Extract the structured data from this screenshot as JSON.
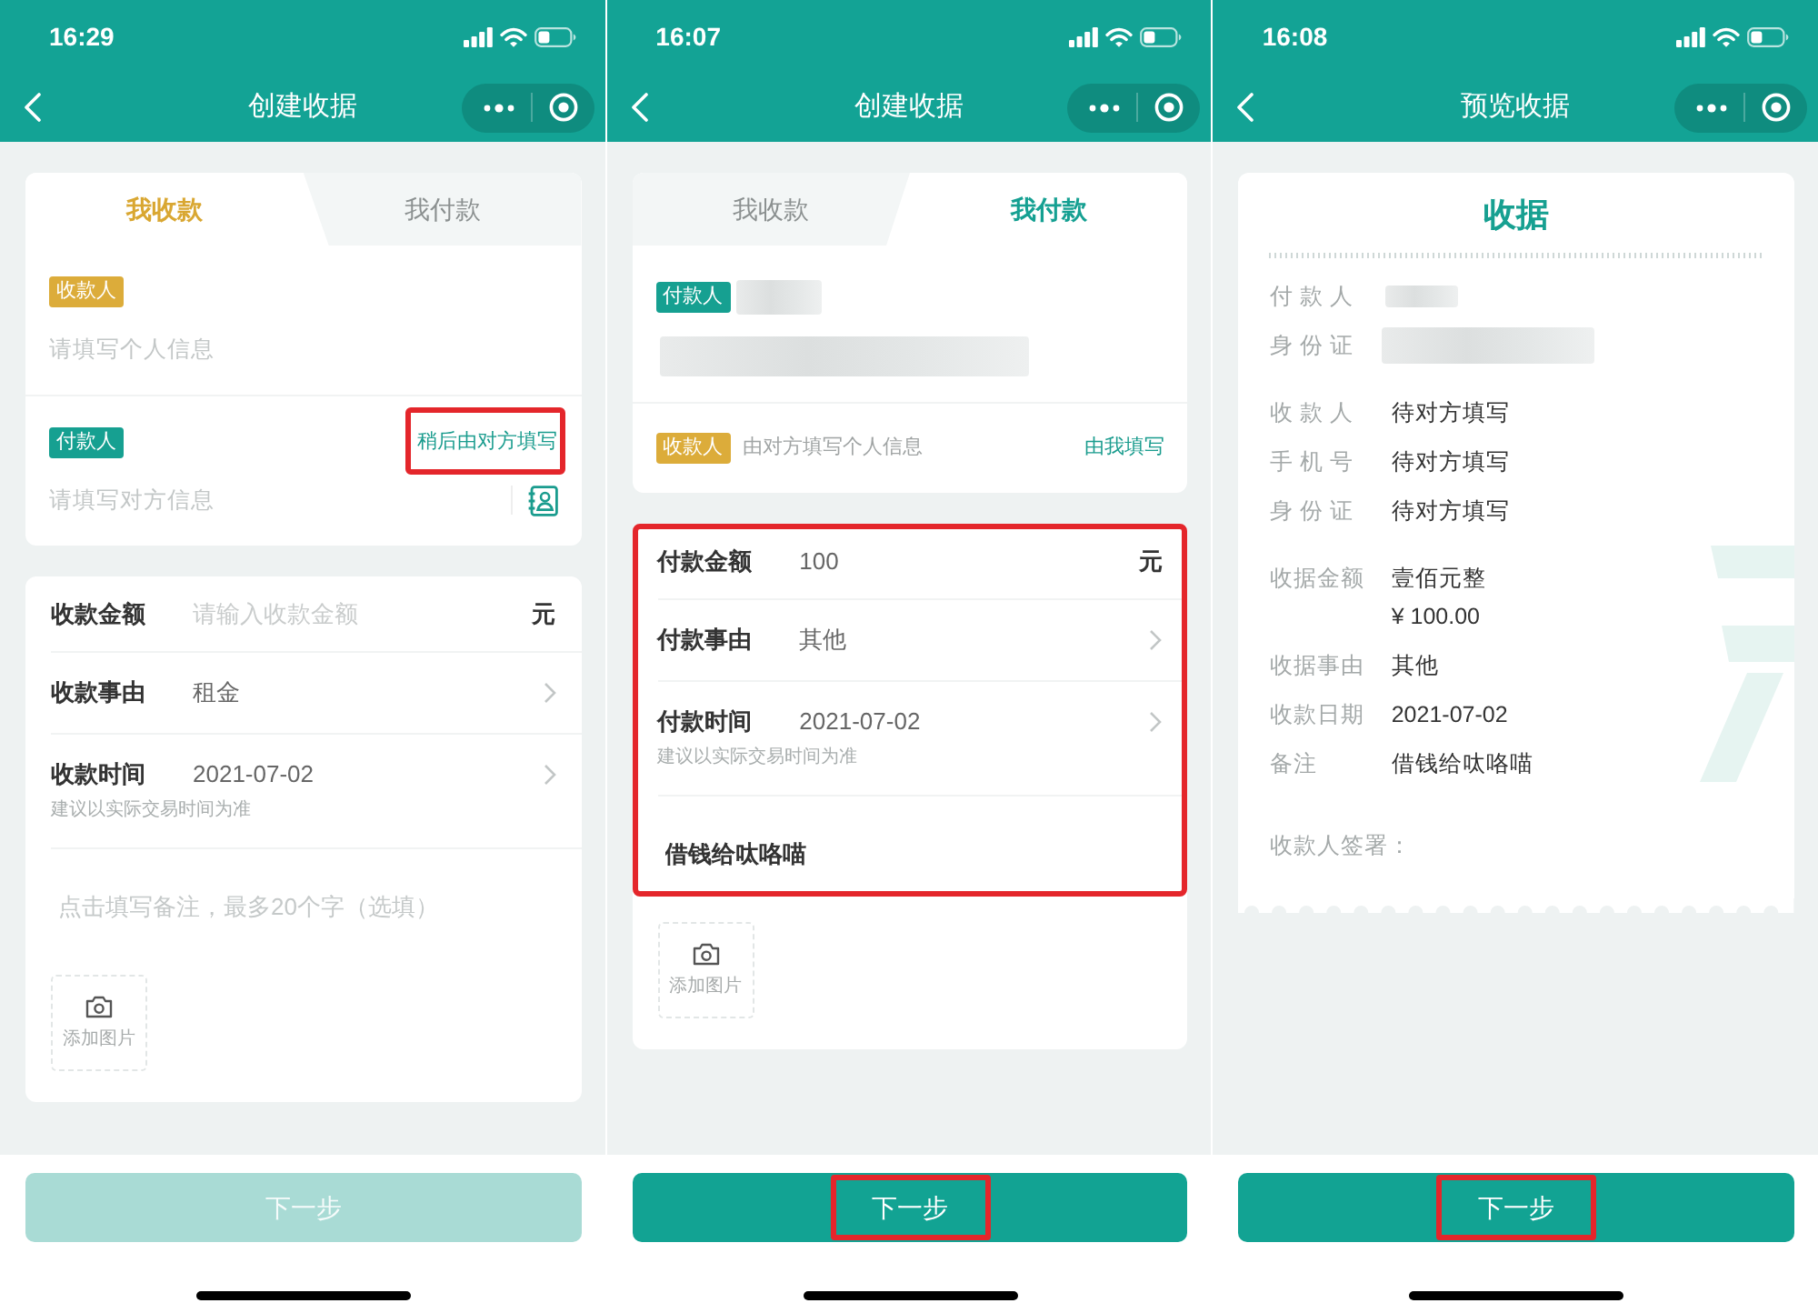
{
  "screens": [
    {
      "kind": "form",
      "status_bar": {
        "time": "16:29"
      },
      "nav_bar": {
        "title": "创建收据"
      },
      "tabs": [
        {
          "label": "我收款",
          "selected": true
        },
        {
          "label": "我付款",
          "selected": false
        }
      ],
      "parties": [
        {
          "kind": "input",
          "badge": "收款人",
          "color": "#dcac3a",
          "placeholder": "请填写个人信息",
          "contact_button": false
        },
        {
          "kind": "input",
          "badge": "付款人",
          "color": "#16a091",
          "link": {
            "label": "稍后由对方填写",
            "highlighted": true
          },
          "placeholder": "请填写对方信息",
          "contact_button": true
        }
      ],
      "details": {
        "highlighted": false,
        "fields": [
          {
            "kind": "amount",
            "label": "收款金额",
            "placeholder": "请输入收款金额",
            "unit": "元"
          },
          {
            "kind": "select",
            "label": "收款事由",
            "value": "租金"
          },
          {
            "kind": "select",
            "label": "收款时间",
            "value": "2021-07-02",
            "hint": "建议以实际交易时间为准"
          },
          {
            "kind": "remark",
            "placeholder": "点击填写备注，最多20个字（选填）"
          }
        ]
      },
      "photo_button": {
        "label": "添加图片"
      },
      "next_button": {
        "label": "下一步",
        "disabled": true,
        "highlighted": false
      }
    },
    {
      "kind": "form",
      "status_bar": {
        "time": "16:07"
      },
      "nav_bar": {
        "title": "创建收据"
      },
      "tabs": [
        {
          "label": "我收款",
          "selected": false
        },
        {
          "label": "我付款",
          "selected": true
        }
      ],
      "parties": [
        {
          "kind": "filled",
          "badge": "付款人",
          "color": "#16a091",
          "redacted": true
        },
        {
          "kind": "inline",
          "badge": "收款人",
          "color": "#dcac3a",
          "note": "由对方填写个人信息",
          "link": {
            "label": "由我填写",
            "highlighted": false
          }
        }
      ],
      "details": {
        "highlighted": true,
        "fields": [
          {
            "kind": "amount",
            "label": "付款金额",
            "value": "100",
            "unit": "元"
          },
          {
            "kind": "select",
            "label": "付款事由",
            "value": "其他"
          },
          {
            "kind": "select",
            "label": "付款时间",
            "value": "2021-07-02",
            "hint": "建议以实际交易时间为准"
          },
          {
            "kind": "remark",
            "value": "借钱给呔咯喵"
          }
        ]
      },
      "photo_button": {
        "label": "添加图片"
      },
      "next_button": {
        "label": "下一步",
        "disabled": false,
        "highlighted": true
      }
    },
    {
      "kind": "preview",
      "status_bar": {
        "time": "16:08"
      },
      "nav_bar": {
        "title": "预览收据"
      },
      "receipt": {
        "title": "收据",
        "groups": [
          {
            "rows": [
              {
                "label": "付 款 人",
                "redacted": true
              },
              {
                "label": "身 份 证",
                "redacted": true
              }
            ]
          },
          {
            "rows": [
              {
                "label": "收 款 人",
                "value": "待对方填写",
                "redacted": false
              },
              {
                "label": "手 机 号",
                "value": "待对方填写",
                "redacted": false
              },
              {
                "label": "身 份 证",
                "value": "待对方填写",
                "redacted": false
              }
            ]
          },
          {
            "rows": [
              {
                "label": "收据金额",
                "value": "壹佰元整",
                "subvalue": "¥ 100.00",
                "redacted": false
              },
              {
                "label": "收据事由",
                "value": "其他",
                "redacted": false
              },
              {
                "label": "收款日期",
                "value": "2021-07-02",
                "redacted": false
              },
              {
                "label": "备注",
                "value": "借钱给呔咯喵",
                "redacted": false
              }
            ]
          }
        ],
        "signature_label": "收款人签署："
      },
      "next_button": {
        "label": "下一步",
        "disabled": false,
        "highlighted": true
      }
    }
  ]
}
